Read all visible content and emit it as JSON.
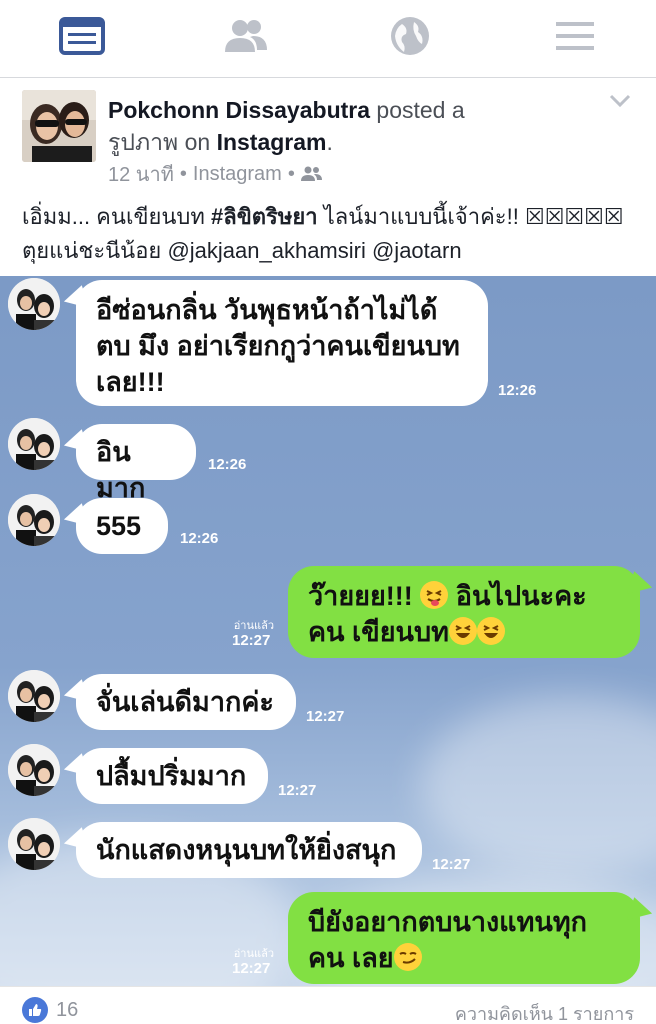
{
  "nav": {
    "items": [
      {
        "icon": "news-feed-icon",
        "active": true
      },
      {
        "icon": "friends-icon",
        "active": false
      },
      {
        "icon": "globe-icon",
        "active": false
      },
      {
        "icon": "menu-icon",
        "active": false
      }
    ],
    "active_color": "#3b5998",
    "inactive_color": "#bdc1c9"
  },
  "post": {
    "author": "Pokchonn Dissayabutra",
    "posted_a": "posted a",
    "object": "รูปภาพ",
    "on": "on",
    "app": "Instagram",
    "period": ".",
    "time": "12 นาที",
    "source": "Instagram",
    "sep": "•",
    "caption_prefix": "เอิ่มม... คนเขียนบท ",
    "caption_tag": "#ลิขิตริษยา",
    "caption_suffix": " ไลน์มาแบบนี้เจ้าค่ะ!! ",
    "caption_box": "☒☒☒☒☒",
    "caption_line2": "ตุยแน่ชะนีน้อย @jakjaan_akhamsiri @jaotarn"
  },
  "chat": {
    "messages": [
      {
        "dir": "in",
        "text": "อีซ่อนกลิ่น วันพุธหน้าถ้าไม่ได้ตบ มึง อย่าเรียกกูว่าคนเขียนบท เลย!!!",
        "time": "12:26"
      },
      {
        "dir": "in",
        "text": "อินมาก",
        "time": "12:26"
      },
      {
        "dir": "in",
        "text": "555",
        "time": "12:26"
      },
      {
        "dir": "out",
        "text": "ว๊ายยย!!! ",
        "text2": " อินไปนะคะคน เขียนบท",
        "time": "12:27",
        "read": "อ่านแล้ว"
      },
      {
        "dir": "in",
        "text": "จั่นเล่นดีมากค่ะ",
        "time": "12:27"
      },
      {
        "dir": "in",
        "text": "ปลื้มปริ่มมาก",
        "time": "12:27"
      },
      {
        "dir": "in",
        "text": "นักแสดงหนุนบทให้ยิ่งสนุก",
        "time": "12:27"
      },
      {
        "dir": "out",
        "text": "บียังอยากตบนางแทนทุกคน เลย",
        "time": "12:27",
        "read": "อ่านแล้ว"
      }
    ]
  },
  "footer": {
    "likes": "16",
    "comments": "ความคิดเห็น 1 รายการ"
  }
}
